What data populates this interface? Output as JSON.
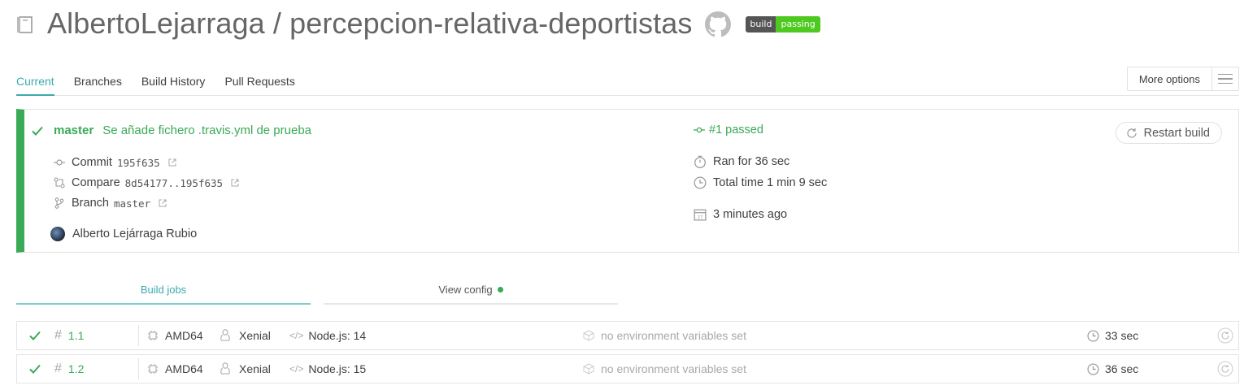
{
  "header": {
    "repo_title": "AlbertoLejarraga / percepcion-relativa-deportistas",
    "badge_left": "build",
    "badge_right": "passing"
  },
  "tabs": [
    {
      "label": "Current",
      "active": true
    },
    {
      "label": "Branches",
      "active": false
    },
    {
      "label": "Build History",
      "active": false
    },
    {
      "label": "Pull Requests",
      "active": false
    }
  ],
  "more_options_label": "More options",
  "build": {
    "branch": "master",
    "commit_message": "Se añade fichero .travis.yml de prueba",
    "commit_label": "Commit",
    "commit_sha": "195f635",
    "compare_label": "Compare",
    "compare_range": "8d54177..195f635",
    "branch_label": "Branch",
    "branch_value": "master",
    "author": "Alberto Lejárraga Rubio",
    "status": "#1 passed",
    "ran_for": "Ran for 36 sec",
    "total_time": "Total time 1 min 9 sec",
    "finished": "3 minutes ago",
    "restart_label": "Restart build"
  },
  "jobs_tabs": {
    "build_jobs": "Build jobs",
    "view_config": "View config"
  },
  "jobs": [
    {
      "number": "1.1",
      "arch": "AMD64",
      "os": "Xenial",
      "lang": "Node.js: 14",
      "env": "no environment variables set",
      "duration": "33 sec"
    },
    {
      "number": "1.2",
      "arch": "AMD64",
      "os": "Xenial",
      "lang": "Node.js: 15",
      "env": "no environment variables set",
      "duration": "36 sec"
    }
  ],
  "colors": {
    "passed": "#39aa56",
    "accent": "#3eaaaf",
    "badge_passing": "#4ec920"
  }
}
